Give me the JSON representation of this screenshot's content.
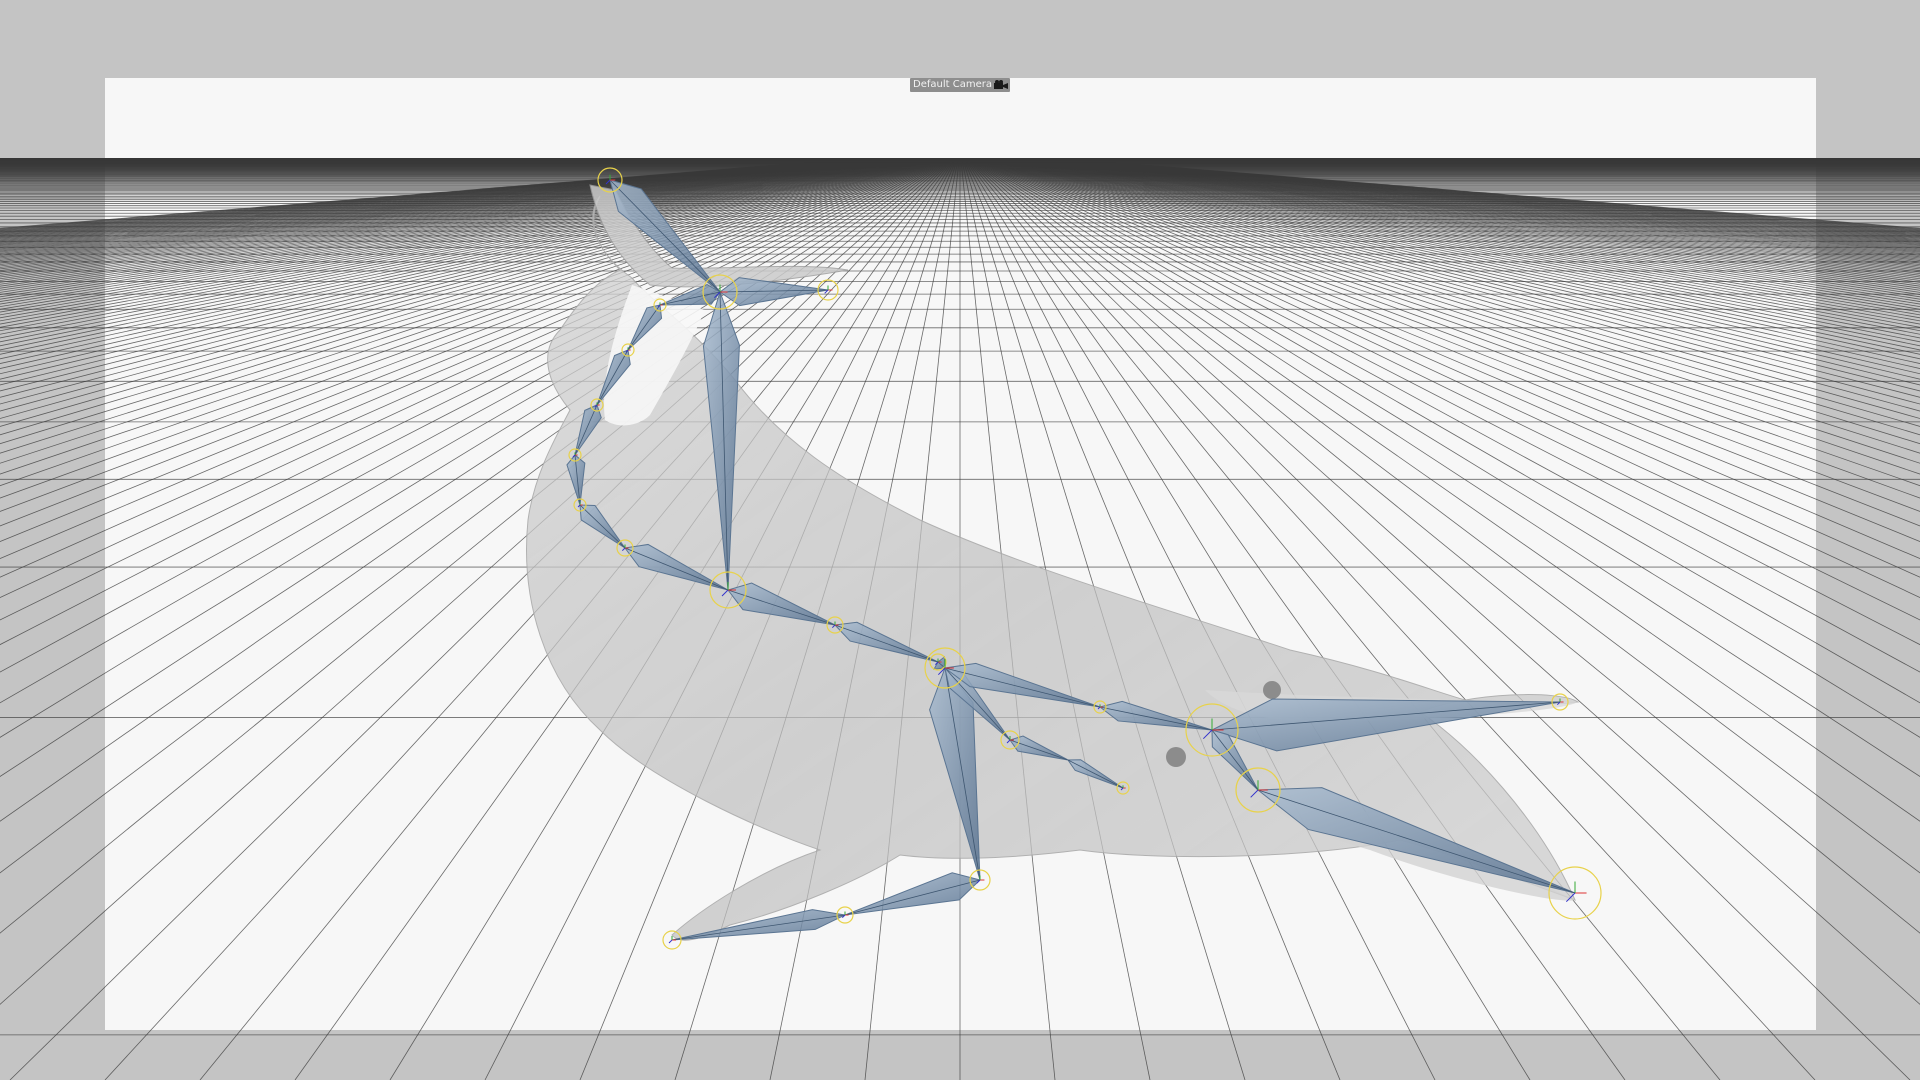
{
  "viewport": {
    "camera_label": "Default Camera",
    "camera_icon": "camera-icon",
    "background_color": "#c4c4c4",
    "safe_frame_color": "#f7f7f7",
    "grid_color": "#3a3a3a",
    "bone_color": "#7d93ab",
    "mesh_color": "#b9b9b9",
    "joint_ring_color": "#e8d24a"
  }
}
